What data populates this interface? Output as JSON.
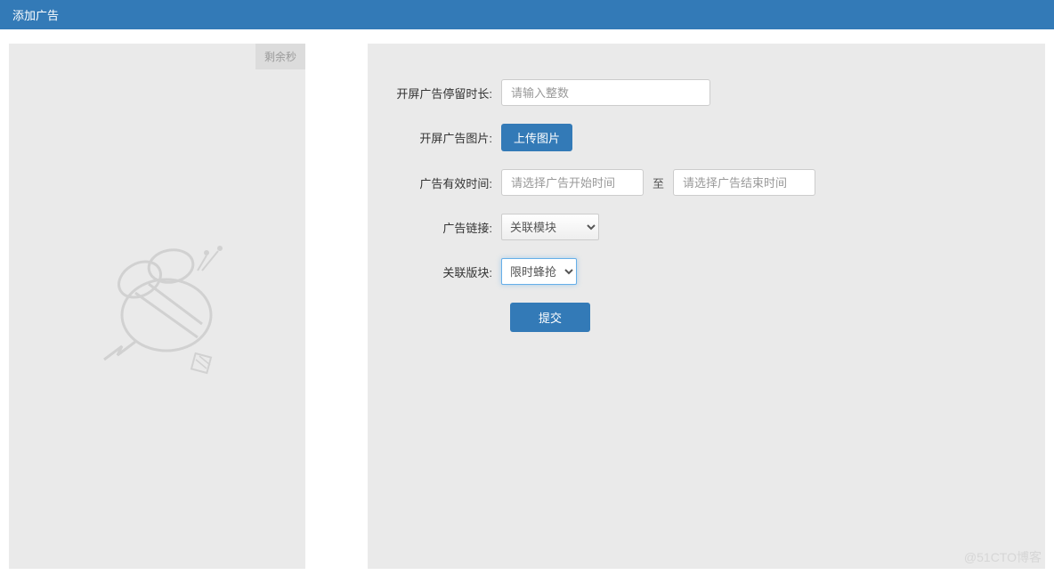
{
  "header": {
    "title": "添加广告"
  },
  "leftPanel": {
    "countdown": "剩余秒"
  },
  "form": {
    "duration": {
      "label": "开屏广告停留时长:",
      "placeholder": "请输入整数"
    },
    "image": {
      "label": "开屏广告图片:",
      "button": "上传图片"
    },
    "validTime": {
      "label": "广告有效时间:",
      "startPlaceholder": "请选择广告开始时间",
      "separator": "至",
      "endPlaceholder": "请选择广告结束时间"
    },
    "adLink": {
      "label": "广告链接:",
      "selected": "关联模块"
    },
    "module": {
      "label": "关联版块:",
      "selected": "限时蜂抢"
    },
    "submit": "提交"
  },
  "watermark": "@51CTO博客"
}
